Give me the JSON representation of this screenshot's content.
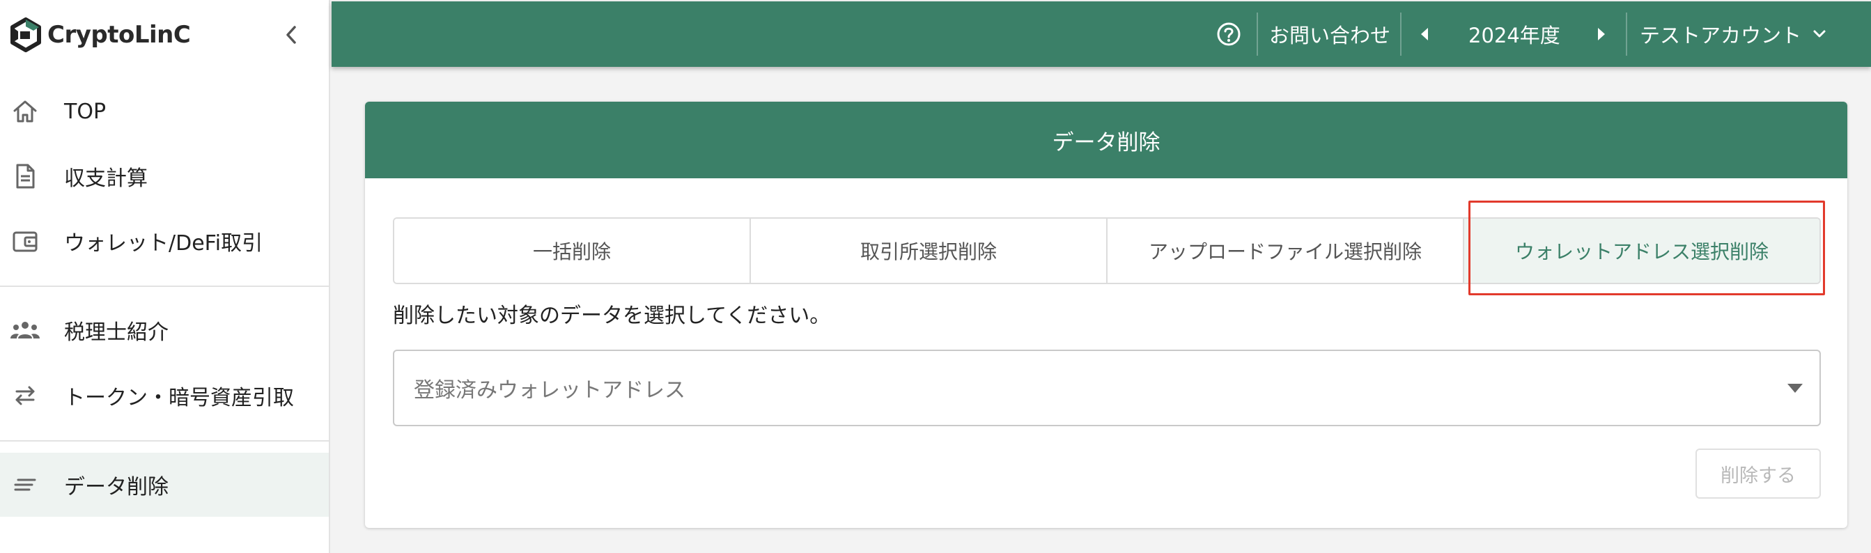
{
  "app": {
    "brand_name": "CryptoLinC"
  },
  "sidebar": {
    "items": [
      {
        "label": "TOP",
        "icon": "home-icon"
      },
      {
        "label": "収支計算",
        "icon": "document-icon"
      },
      {
        "label": "ウォレット/DeFi取引",
        "icon": "wallet-icon"
      },
      {
        "label": "税理士紹介",
        "icon": "people-icon"
      },
      {
        "label": "トークン・暗号資産引取",
        "icon": "swap-arrows-icon"
      },
      {
        "label": "データ削除",
        "icon": "lines-icon",
        "active": true
      }
    ]
  },
  "header": {
    "contact_label": "お問い合わせ",
    "year_label": "2024年度",
    "account_label": "テストアカウント"
  },
  "main": {
    "title": "データ削除",
    "tabs": [
      {
        "label": "一括削除"
      },
      {
        "label": "取引所選択削除"
      },
      {
        "label": "アップロードファイル選択削除"
      },
      {
        "label": "ウォレットアドレス選択削除",
        "selected": true
      }
    ],
    "instruction": "削除したい対象のデータを選択してください。",
    "select": {
      "placeholder": "登録済みウォレットアドレス"
    },
    "delete_button_label": "削除する"
  },
  "colors": {
    "brand_green": "#3b8068",
    "active_tab_bg": "#eef4f1",
    "highlight_red": "#e23a2c"
  }
}
